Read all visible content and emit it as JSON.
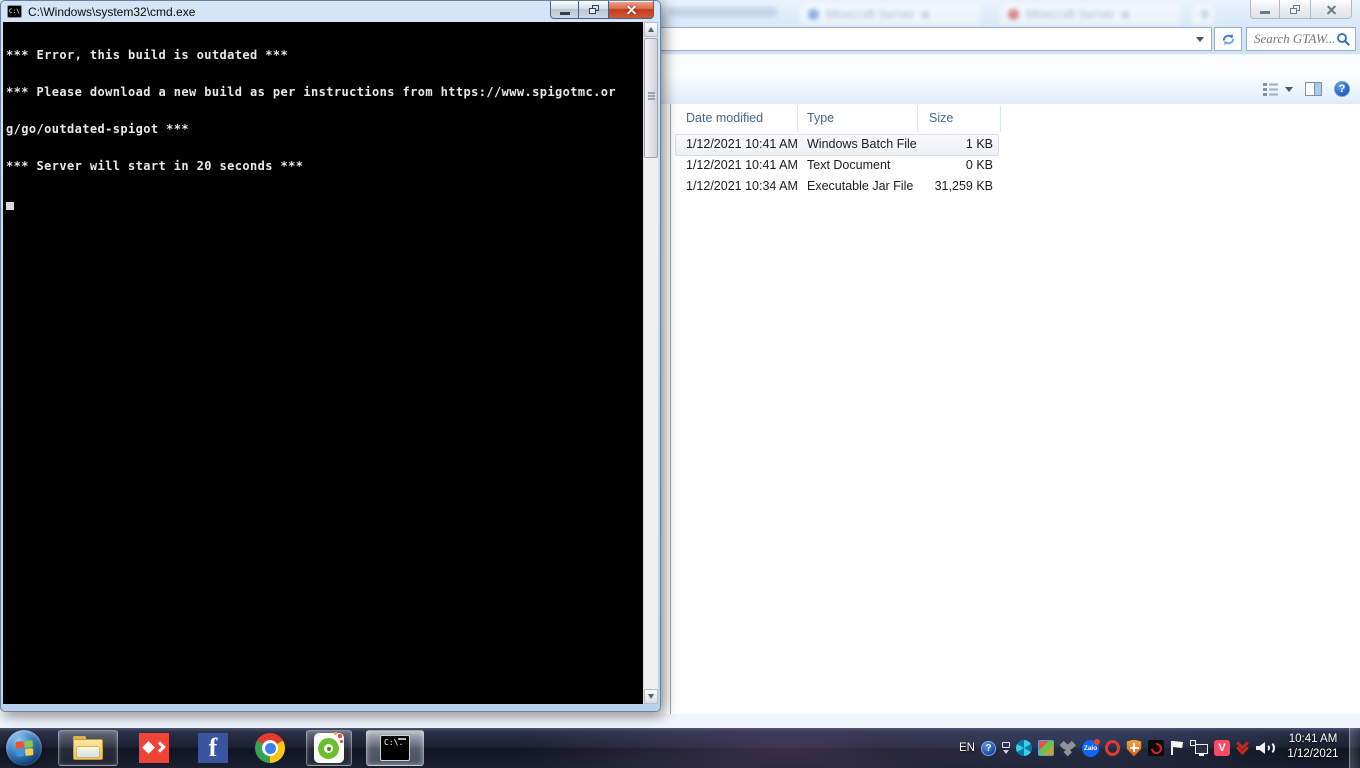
{
  "cmd": {
    "title": "C:\\Windows\\system32\\cmd.exe",
    "icon_label": "C:\\.",
    "console_lines": [
      "*** Error, this build is outdated ***",
      "*** Please download a new build as per instructions from https://www.spigotmc.or",
      "g/go/outdated-spigot ***",
      "*** Server will start in 20 seconds ***"
    ]
  },
  "explorer": {
    "search_placeholder": "Search GTAW...",
    "columns": {
      "date": "Date modified",
      "type": "Type",
      "size": "Size"
    },
    "rows": [
      {
        "date": "1/12/2021 10:41 AM",
        "type": "Windows Batch File",
        "size": "1 KB"
      },
      {
        "date": "1/12/2021 10:41 AM",
        "type": "Text Document",
        "size": "0 KB"
      },
      {
        "date": "1/12/2021 10:34 AM",
        "type": "Executable Jar File",
        "size": "31,259 KB"
      }
    ],
    "help_glyph": "?"
  },
  "browser": {
    "tab1_title": "Minecraft Server",
    "tab2_title": "Minecraft Server"
  },
  "taskbar": {
    "language": "EN",
    "clock_time": "10:41 AM",
    "clock_date": "1/12/2021"
  },
  "tray": {
    "help_glyph": "?",
    "zalo_label": "Zalo",
    "v_label": "V"
  }
}
